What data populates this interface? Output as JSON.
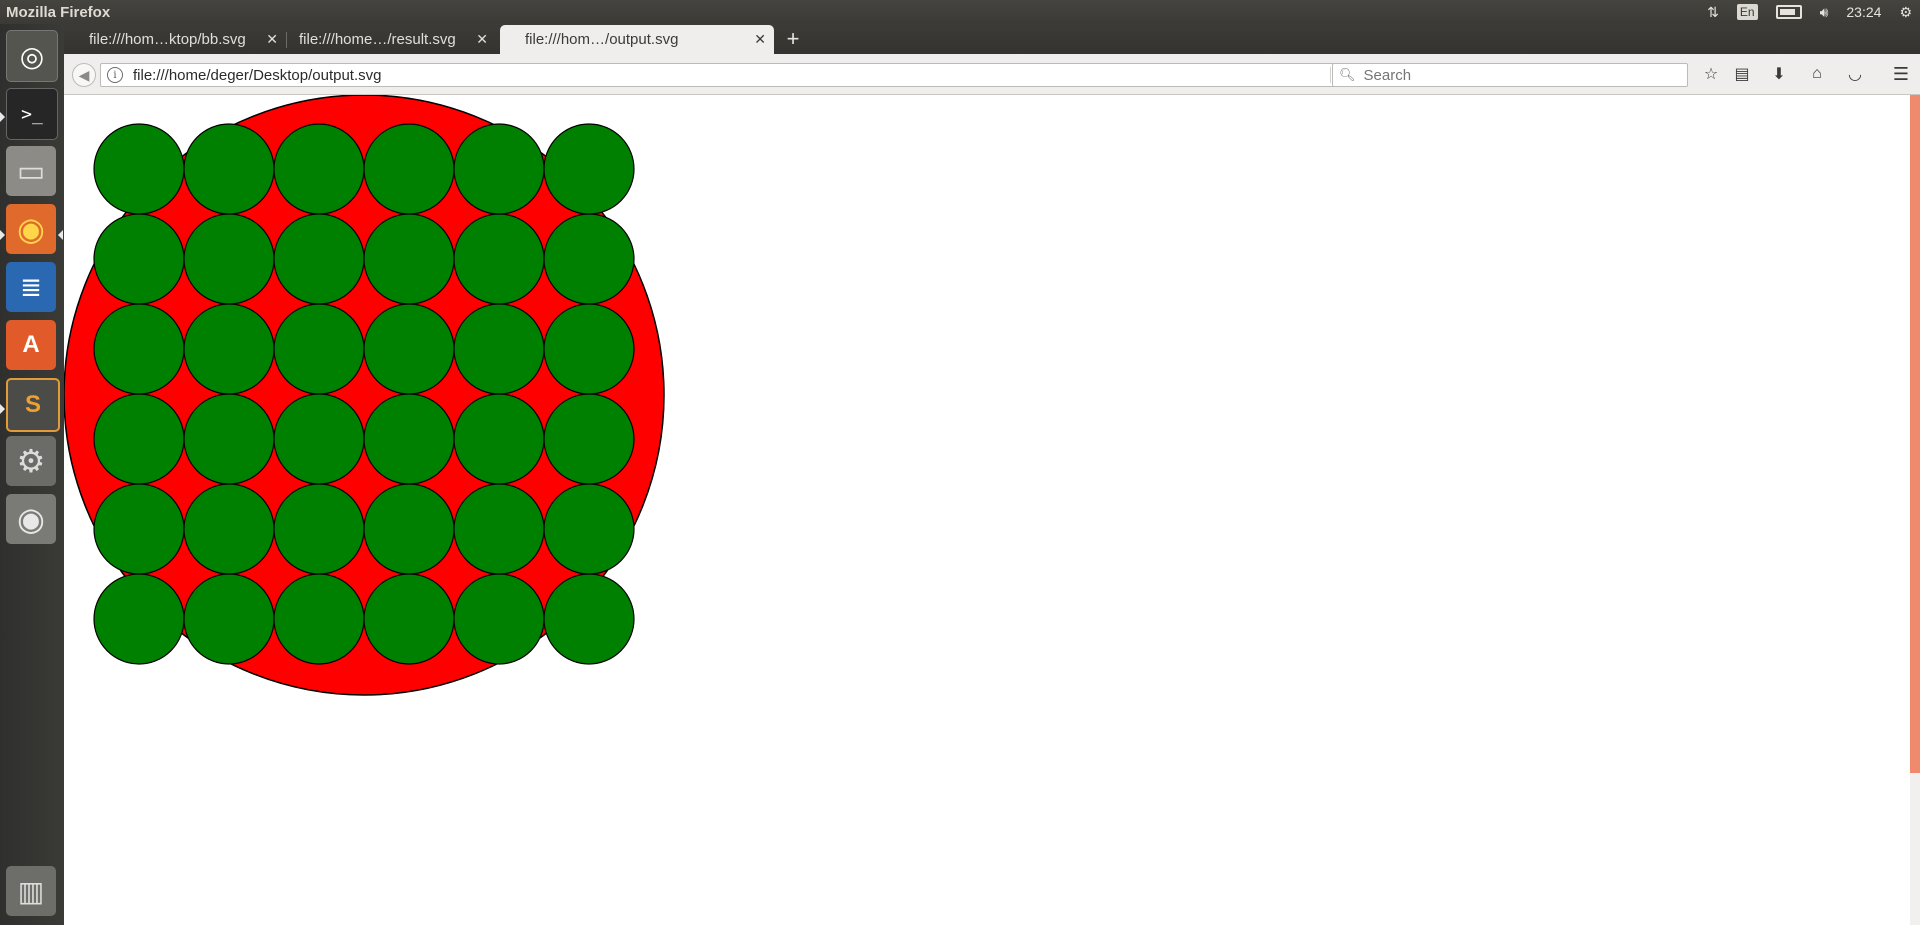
{
  "system": {
    "app_title": "Mozilla Firefox",
    "language": "En",
    "time": "23:24",
    "icons": [
      "network-arrows-icon",
      "keyboard-language-icon",
      "battery-icon",
      "volume-icon",
      "system-gear-icon"
    ]
  },
  "launcher": {
    "items": [
      {
        "name": "ubuntu-dash-icon",
        "glyph": "◎",
        "bg": "#5c5c58"
      },
      {
        "name": "terminal-icon",
        "glyph": ">_",
        "bg": "#2b2b2b"
      },
      {
        "name": "files-icon",
        "glyph": "▭",
        "bg": "#8a8984"
      },
      {
        "name": "firefox-icon",
        "glyph": "◉",
        "bg": "#e26a2c"
      },
      {
        "name": "libreoffice-writer-icon",
        "glyph": "≣",
        "bg": "#2a67b0"
      },
      {
        "name": "software-center-icon",
        "glyph": "A",
        "bg": "#e0582a"
      },
      {
        "name": "sublime-text-icon",
        "glyph": "S",
        "bg": "#4a4a46"
      },
      {
        "name": "system-settings-icon",
        "glyph": "⚙",
        "bg": "#6c6c68"
      },
      {
        "name": "dvd-icon",
        "glyph": "◉",
        "bg": "#7c7c78"
      },
      {
        "name": "trash-icon",
        "glyph": "🗑",
        "bg": "#6e6e6a"
      }
    ]
  },
  "tabs": [
    {
      "label": "file:///hom…ktop/bb.svg",
      "active": false
    },
    {
      "label": "file:///home…/result.svg",
      "active": false
    },
    {
      "label": "file:///hom…/output.svg",
      "active": true
    }
  ],
  "navbar": {
    "url": "file:///home/deger/Desktop/output.svg",
    "search_placeholder": "Search",
    "icons": [
      "bookmark-star-icon",
      "reading-list-icon",
      "downloads-icon",
      "home-icon",
      "pocket-icon",
      "menu-icon"
    ]
  },
  "drawing": {
    "outer_circle_fill": "#ff0000",
    "inner_circle_fill": "#008000",
    "stroke": "#000000",
    "grid_rows": 6,
    "grid_cols": 6
  }
}
